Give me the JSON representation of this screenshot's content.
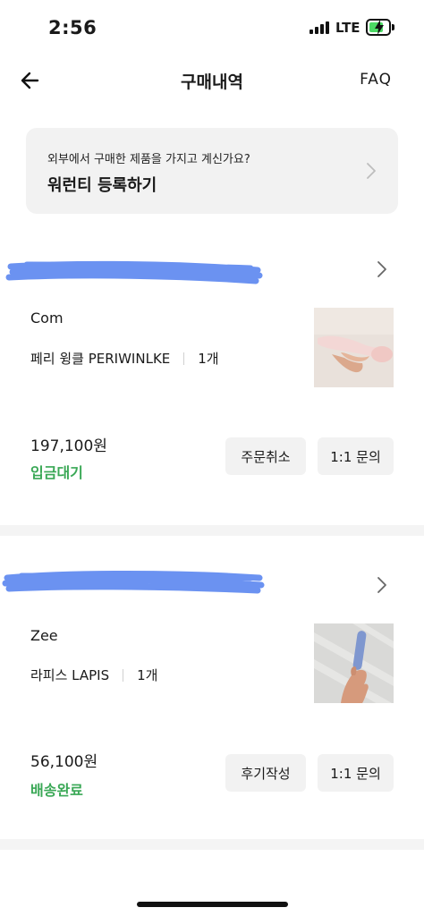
{
  "status_bar": {
    "time": "2:56",
    "network": "LTE",
    "battery_fraction": 0.75,
    "battery_color": "#4cd964"
  },
  "header": {
    "title": "구매내역",
    "faq_label": "FAQ",
    "back_icon": "arrow-left-icon"
  },
  "warranty": {
    "subtitle": "외부에서 구매한 제품을 가지고 계신가요?",
    "title": "워런티 등록하기",
    "icon": "chevron-right-icon"
  },
  "orders": [
    {
      "brand": "Com",
      "product": "페리 윙클 PERIWINLKE",
      "quantity": "1개",
      "price": "197,100원",
      "status": "입금대기",
      "buttons": [
        "주문취소",
        "1:1 문의"
      ]
    },
    {
      "brand": "Zee",
      "product": "라피스 LAPIS",
      "quantity": "1개",
      "price": "56,100원",
      "status": "배송완료",
      "buttons": [
        "후기작성",
        "1:1 문의"
      ]
    }
  ],
  "colors": {
    "status_green": "#3aa856",
    "scribble_blue": "#5b86f0",
    "button_bg": "#f2f2f2"
  }
}
